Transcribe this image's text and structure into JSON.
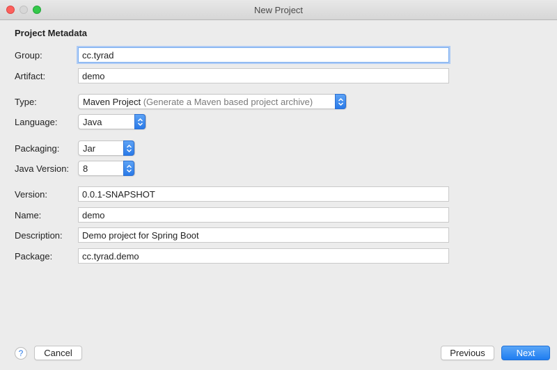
{
  "window": {
    "title": "New Project"
  },
  "section_title": "Project Metadata",
  "fields": {
    "group": {
      "label": "Group:",
      "value": "cc.tyrad"
    },
    "artifact": {
      "label": "Artifact:",
      "value": "demo"
    },
    "type": {
      "label": "Type:",
      "value": "Maven Project",
      "hint": "(Generate a Maven based project archive)"
    },
    "language": {
      "label": "Language:",
      "value": "Java"
    },
    "packaging": {
      "label": "Packaging:",
      "value": "Jar"
    },
    "java_version": {
      "label": "Java Version:",
      "value": "8"
    },
    "version": {
      "label": "Version:",
      "value": "0.0.1-SNAPSHOT"
    },
    "name": {
      "label": "Name:",
      "value": "demo"
    },
    "description": {
      "label": "Description:",
      "value": "Demo project for Spring Boot"
    },
    "package": {
      "label": "Package:",
      "value": "cc.tyrad.demo"
    }
  },
  "buttons": {
    "help": "?",
    "cancel": "Cancel",
    "previous": "Previous",
    "next": "Next"
  },
  "colors": {
    "accent": "#2a7ae8",
    "close": "#fc605c",
    "maximize": "#34c84a",
    "focus_ring": "#aecbf5"
  }
}
